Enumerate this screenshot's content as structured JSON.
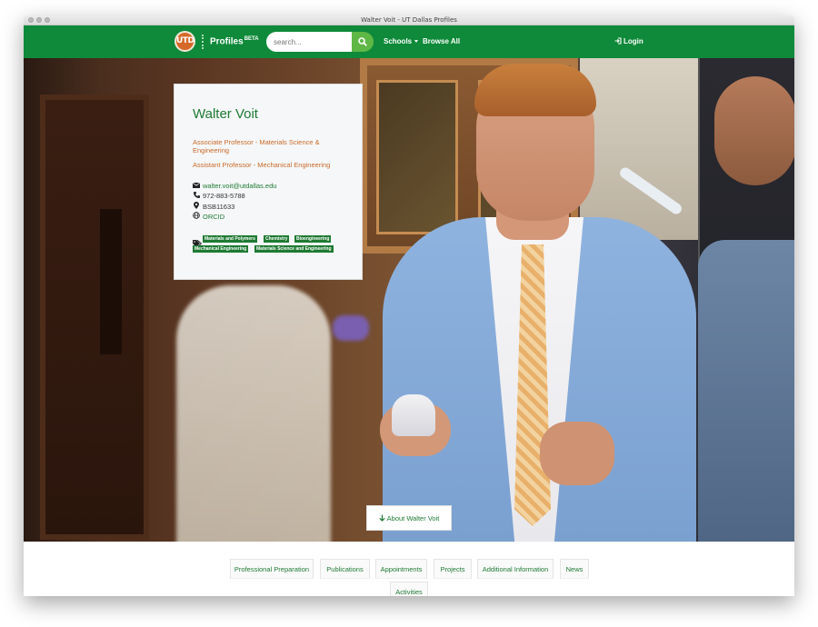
{
  "window": {
    "title": "Walter Voit - UT Dallas Profiles"
  },
  "navbar": {
    "logo_text": "UTD",
    "brand": "Profiles",
    "brand_badge": "BETA",
    "search_placeholder": "search...",
    "schools_label": "Schools",
    "browse_label": "Browse All",
    "login_label": "Login",
    "colors": {
      "bar": "#0f8a3a",
      "search_button": "#5fb746",
      "logo": "#d5692a"
    }
  },
  "profile": {
    "name": "Walter Voit",
    "roles": [
      "Associate Professor - Materials Science & Engineering",
      "Assistant Professor - Mechanical Engineering"
    ],
    "email": "walter.voit@utdallas.edu",
    "phone": "972-883-5788",
    "office": "BSB11633",
    "orcid": "ORCID",
    "tags": [
      "Materials and Polymers",
      "Chemistry",
      "Bioengineering",
      "Mechanical Engineering",
      "Materials Science and Engineering"
    ]
  },
  "hero": {
    "about_button": "About Walter Voit"
  },
  "tabs": [
    "Professional Preparation",
    "Publications",
    "Appointments",
    "Projects",
    "Additional Information",
    "News",
    "Activities"
  ]
}
